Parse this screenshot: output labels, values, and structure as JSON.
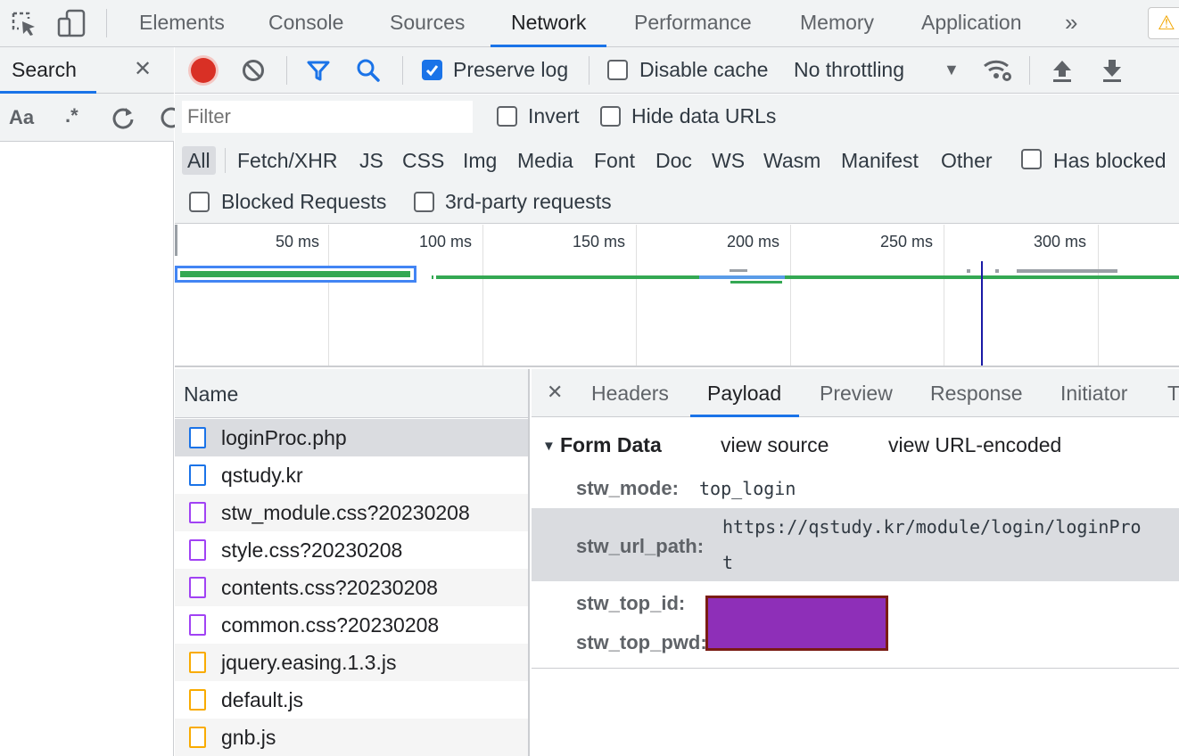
{
  "devtools": {
    "tabs": [
      "Elements",
      "Console",
      "Sources",
      "Network",
      "Performance",
      "Memory",
      "Application"
    ],
    "active_tab": "Network",
    "more_tabs_glyph": "»",
    "warning_badge": "⚠"
  },
  "search_pane": {
    "title": "Search",
    "close_glyph": "✕",
    "case_toggle": "Aa",
    "regex_toggle": ".*"
  },
  "network_toolbar": {
    "preserve_log_label": "Preserve log",
    "preserve_log_checked": true,
    "disable_cache_label": "Disable cache",
    "disable_cache_checked": false,
    "throttling": "No throttling"
  },
  "filter_bar": {
    "filter_placeholder": "Filter",
    "invert_label": "Invert",
    "hide_data_urls_label": "Hide data URLs",
    "types": [
      "All",
      "Fetch/XHR",
      "JS",
      "CSS",
      "Img",
      "Media",
      "Font",
      "Doc",
      "WS",
      "Wasm",
      "Manifest",
      "Other"
    ],
    "active_type": "All",
    "has_blocked_label": "Has blocked",
    "blocked_requests_label": "Blocked Requests",
    "third_party_label": "3rd-party requests"
  },
  "overview": {
    "ticks": [
      "50 ms",
      "100 ms",
      "150 ms",
      "200 ms",
      "250 ms",
      "300 ms"
    ]
  },
  "request_list": {
    "column_name": "Name",
    "requests": [
      {
        "name": "loginProc.php",
        "type": "doc"
      },
      {
        "name": "qstudy.kr",
        "type": "doc"
      },
      {
        "name": "stw_module.css?20230208",
        "type": "css"
      },
      {
        "name": "style.css?20230208",
        "type": "css"
      },
      {
        "name": "contents.css?20230208",
        "type": "css"
      },
      {
        "name": "common.css?20230208",
        "type": "css"
      },
      {
        "name": "jquery.easing.1.3.js",
        "type": "js"
      },
      {
        "name": "default.js",
        "type": "js"
      },
      {
        "name": "gnb.js",
        "type": "js"
      }
    ],
    "selected_index": 0
  },
  "details": {
    "close_glyph": "✕",
    "tabs": [
      "Headers",
      "Payload",
      "Preview",
      "Response",
      "Initiator",
      "T"
    ],
    "active_tab": "Payload",
    "section_title": "Form Data",
    "view_source": "view source",
    "view_url_encoded": "view URL-encoded",
    "fields": [
      {
        "key": "stw_mode:",
        "value": "top_login"
      },
      {
        "key": "stw_url_path:",
        "value": "https://qstudy.kr/module/login/loginPro",
        "value_wrap": "t"
      },
      {
        "key": "stw_top_id:",
        "value": ""
      },
      {
        "key": "stw_top_pwd:",
        "value": ""
      }
    ],
    "redaction_color": "#8e2fb8"
  }
}
